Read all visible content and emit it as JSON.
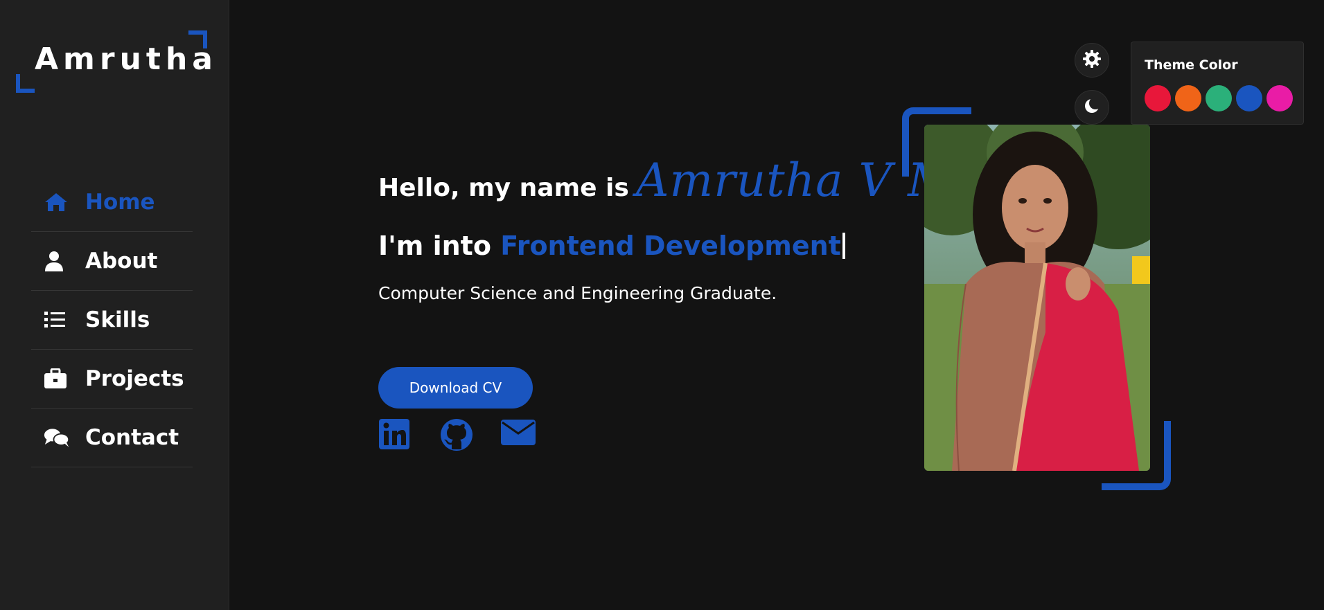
{
  "brand": {
    "logo_text": "Amrutha"
  },
  "sidebar": {
    "items": [
      {
        "label": "Home",
        "icon": "home-icon",
        "active": true
      },
      {
        "label": "About",
        "icon": "user-icon",
        "active": false
      },
      {
        "label": "Skills",
        "icon": "list-icon",
        "active": false
      },
      {
        "label": "Projects",
        "icon": "briefcase-icon",
        "active": false
      },
      {
        "label": "Contact",
        "icon": "comments-icon",
        "active": false
      }
    ]
  },
  "hero": {
    "greeting": "Hello, my name is",
    "name": "Amrutha V M",
    "role_prefix": "I'm into",
    "role_highlight": "Frontend Development",
    "subtitle": "Computer Science and Engineering Graduate.",
    "cv_button": "Download CV",
    "socials": [
      "linkedin-icon",
      "github-icon",
      "envelope-icon"
    ],
    "photo_alt": "Amrutha V M"
  },
  "theme": {
    "title": "Theme Color",
    "swatches": [
      "#e8173a",
      "#f06418",
      "#2bb07a",
      "#1a55bf",
      "#e91ca6"
    ],
    "accent": "#1a55bf"
  },
  "controls": {
    "settings_icon": "gear-icon",
    "mode_icon": "moon-icon"
  }
}
